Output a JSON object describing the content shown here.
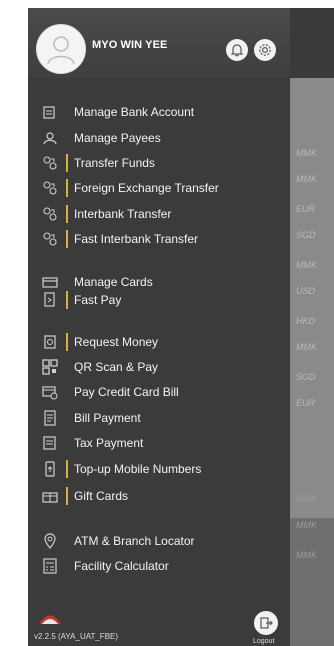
{
  "user": {
    "name": "MYO WIN YEE"
  },
  "menu": [
    {
      "label": "Manage Bank Account",
      "icon": "bank-account-icon",
      "bar": false
    },
    {
      "label": "Manage Payees",
      "icon": "payees-icon",
      "bar": false
    },
    {
      "label": "Transfer Funds",
      "icon": "transfer-icon",
      "bar": true
    },
    {
      "label": "Foreign Exchange Transfer",
      "icon": "transfer-icon",
      "bar": true
    },
    {
      "label": "Interbank Transfer",
      "icon": "transfer-icon",
      "bar": true
    },
    {
      "label": "Fast Interbank Transfer",
      "icon": "transfer-icon",
      "bar": true
    },
    {
      "label": "Manage Cards",
      "icon": "card-icon",
      "bar": false
    },
    {
      "label": "Fast Pay",
      "icon": "fast-pay-icon",
      "bar": true
    },
    {
      "label": "Request Money",
      "icon": "request-money-icon",
      "bar": true
    },
    {
      "label": "QR Scan & Pay",
      "icon": "qr-icon",
      "bar": false
    },
    {
      "label": "Pay Credit Card Bill",
      "icon": "credit-card-bill-icon",
      "bar": false
    },
    {
      "label": "Bill Payment",
      "icon": "bill-icon",
      "bar": false
    },
    {
      "label": "Tax Payment",
      "icon": "tax-icon",
      "bar": false
    },
    {
      "label": "Top-up Mobile Numbers",
      "icon": "mobile-topup-icon",
      "bar": true
    },
    {
      "label": "Gift Cards",
      "icon": "gift-card-icon",
      "bar": true
    },
    {
      "label": "ATM & Branch Locator",
      "icon": "location-icon",
      "bar": false
    },
    {
      "label": "Facility Calculator",
      "icon": "calculator-icon",
      "bar": false
    }
  ],
  "background_chips": [
    "MMK",
    "MMK",
    "EUR",
    "SGD",
    "MMK",
    "USD",
    "HKD",
    "MMK",
    "SGD",
    "EUR",
    "MMK",
    "MMK",
    "MMK"
  ],
  "footer": {
    "version": "v2.2.5 (AYA_UAT_FBE)",
    "logout_label": "Logout"
  },
  "colors": {
    "drawer": "#3b3b3b",
    "accent_bar": "#d6b238",
    "logo": "#c0392b"
  }
}
